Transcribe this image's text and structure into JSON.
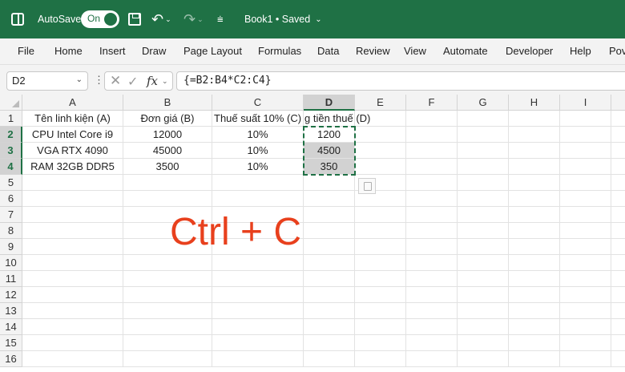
{
  "app": {
    "autosave_label": "AutoSave",
    "autosave_state": "On",
    "doc_title": "Book1 • Saved",
    "brand_color": "#1f7145"
  },
  "icons": [
    "excel-logo-icon",
    "save-icon",
    "undo-icon",
    "redo-icon",
    "customize-qat-icon",
    "cancel-icon",
    "enter-icon",
    "insert-function-icon",
    "paste-options-icon"
  ],
  "ribbon": {
    "tabs": [
      "File",
      "Home",
      "Insert",
      "Draw",
      "Page Layout",
      "Formulas",
      "Data",
      "Review",
      "View",
      "Automate",
      "Developer",
      "Help",
      "Pov"
    ]
  },
  "formula_bar": {
    "name_box": "D2",
    "fx_label": "fx",
    "formula": "{=B2:B4*C2:C4}"
  },
  "sheet": {
    "columns": [
      "A",
      "B",
      "C",
      "D",
      "E",
      "F",
      "G",
      "H",
      "I"
    ],
    "rows": [
      "1",
      "2",
      "3",
      "4",
      "5",
      "6",
      "7",
      "8",
      "9",
      "10",
      "11",
      "12",
      "13",
      "14",
      "15",
      "16"
    ],
    "selected_column": "D",
    "selected_rows": [
      "2",
      "3",
      "4"
    ],
    "headers": [
      "Tên linh kiện (A)",
      "Đơn giá (B)",
      "Thuế suất 10% (C)",
      "g tiền thuế (D)"
    ],
    "data_rows": [
      [
        "CPU Intel Core i9",
        "12000",
        "10%",
        "1200"
      ],
      [
        "VGA RTX 4090",
        "45000",
        "10%",
        "4500"
      ],
      [
        "RAM 32GB DDR5",
        "3500",
        "10%",
        "350"
      ]
    ]
  },
  "overlay_text": "Ctrl + C",
  "overlay_color": "#e8401d"
}
